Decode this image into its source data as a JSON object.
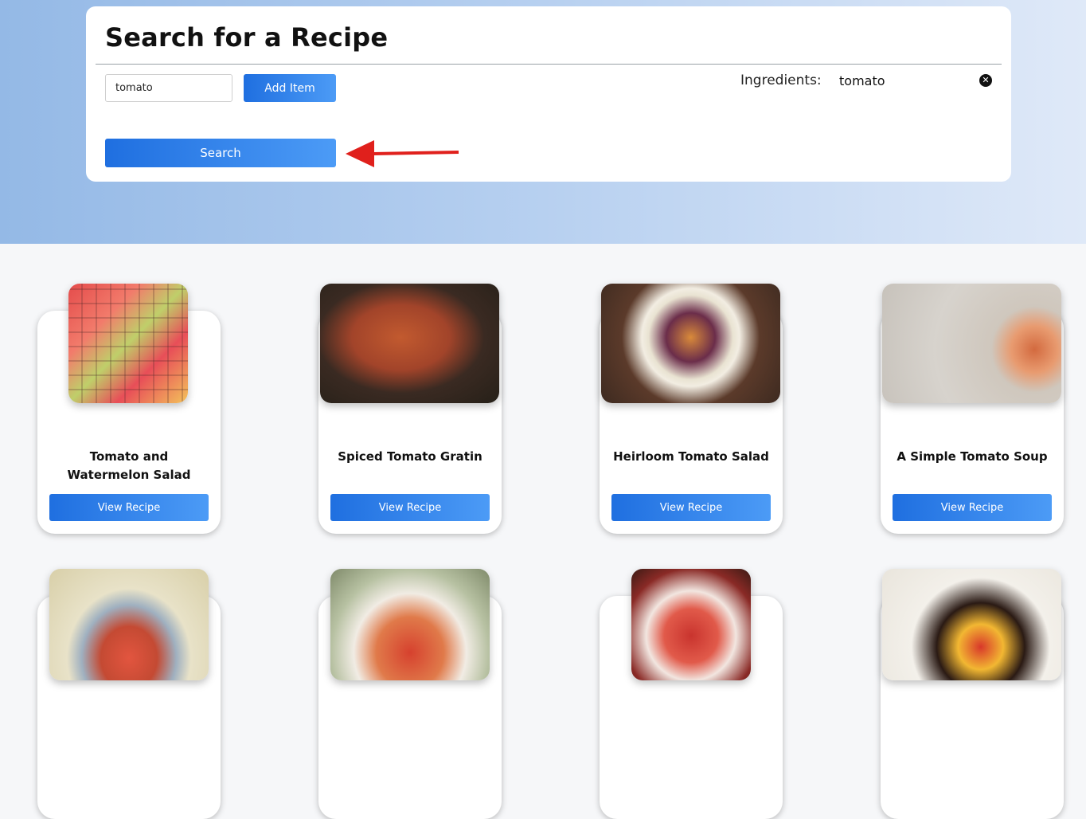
{
  "search_panel": {
    "title": "Search for a Recipe",
    "input_value": "tomato",
    "add_button": "Add Item",
    "search_button": "Search",
    "ingredients_label": "Ingredients:",
    "ingredients": [
      "tomato"
    ],
    "remove_icon": "✕"
  },
  "recipes": [
    {
      "title": "Tomato and Watermelon Salad",
      "button": "View Recipe"
    },
    {
      "title": "Spiced Tomato Gratin",
      "button": "View Recipe"
    },
    {
      "title": "Heirloom Tomato Salad",
      "button": "View Recipe"
    },
    {
      "title": "A Simple Tomato Soup",
      "button": "View Recipe"
    },
    {
      "title": "",
      "button": ""
    },
    {
      "title": "",
      "button": ""
    },
    {
      "title": "",
      "button": ""
    },
    {
      "title": "",
      "button": ""
    }
  ],
  "colors": {
    "accent_start": "#1f6fe0",
    "accent_end": "#4c9bf6",
    "annotation_arrow": "#e0201c"
  }
}
